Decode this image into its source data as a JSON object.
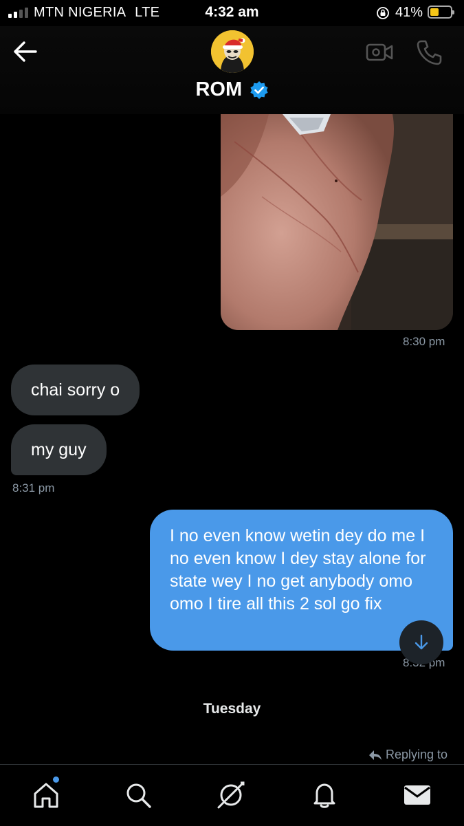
{
  "status_bar": {
    "carrier": "MTN NIGERIA",
    "network": "LTE",
    "time": "4:32 am",
    "battery_percent": "41%",
    "battery_level": 0.41
  },
  "header": {
    "contact_name": "ROM",
    "verified": true
  },
  "messages": [
    {
      "type": "image",
      "direction": "outgoing",
      "timestamp": "8:30 pm"
    },
    {
      "type": "text",
      "direction": "incoming",
      "text": "chai sorry o"
    },
    {
      "type": "text",
      "direction": "incoming",
      "text": "my guy",
      "timestamp": "8:31 pm"
    },
    {
      "type": "text",
      "direction": "outgoing",
      "text": "I no even know wetin dey do me I no even know I dey stay alone for state wey I no get anybody omo omo I tire all this 2 sol go fix",
      "timestamp": "8:32 pm"
    }
  ],
  "day_separator": "Tuesday",
  "replying_to": "Replying to",
  "bottom_nav": [
    "home-icon",
    "search-icon",
    "spaces-icon",
    "notifications-icon",
    "messages-icon"
  ],
  "colors": {
    "accent": "#4a99e9",
    "incoming_bubble": "#2f3336",
    "muted": "#8b98a5",
    "background": "#000000"
  }
}
